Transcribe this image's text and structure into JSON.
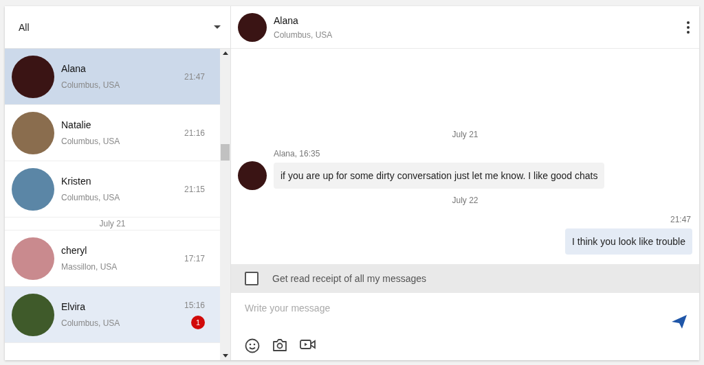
{
  "filter": {
    "value": "All"
  },
  "conversations": [
    {
      "kind": "contact",
      "name": "Alana",
      "location": "Columbus, USA",
      "time": "21:47",
      "selected": true,
      "unread": false
    },
    {
      "kind": "contact",
      "name": "Natalie",
      "location": "Columbus, USA",
      "time": "21:16",
      "selected": false,
      "unread": false
    },
    {
      "kind": "contact",
      "name": "Kristen",
      "location": "Columbus, USA",
      "time": "21:15",
      "selected": false,
      "unread": false
    },
    {
      "kind": "date",
      "label": "July 21"
    },
    {
      "kind": "contact",
      "name": "cheryl",
      "location": "Massillon, USA",
      "time": "17:17",
      "selected": false,
      "unread": false
    },
    {
      "kind": "contact",
      "name": "Elvira",
      "location": "Columbus, USA",
      "time": "15:16",
      "selected": false,
      "unread": true,
      "badge": "1"
    }
  ],
  "chat_header": {
    "name": "Alana",
    "location": "Columbus, USA"
  },
  "messages": [
    {
      "kind": "date",
      "label": "July 21"
    },
    {
      "kind": "incoming",
      "meta": "Alana,  16:35",
      "text": "if you are up for some dirty conversation just let me know. I like good chats"
    },
    {
      "kind": "date",
      "label": "July 22"
    },
    {
      "kind": "outgoing",
      "meta": "21:47",
      "text": "I think you look like trouble"
    }
  ],
  "read_receipt": {
    "label": "Get read receipt of all my messages",
    "checked": false
  },
  "composer": {
    "placeholder": "Write your message"
  }
}
